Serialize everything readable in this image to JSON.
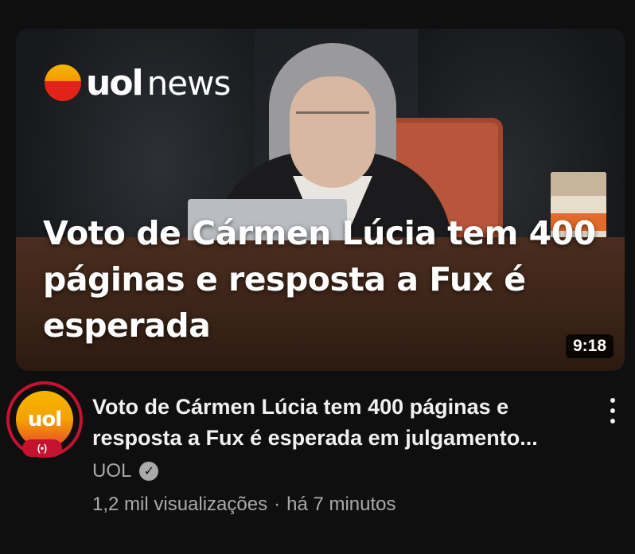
{
  "thumbnail": {
    "logo_brand": "uol",
    "logo_product": "news",
    "overlay_title": "Voto de Cármen Lúcia tem 400 páginas e resposta a Fux é esperada",
    "duration": "9:18"
  },
  "channel": {
    "avatar_text": "uol",
    "live_icon": "(•)",
    "name": "UOL",
    "verified_icon": "✓"
  },
  "video": {
    "title": "Voto de Cármen Lúcia tem 400 páginas e resposta a Fux é esperada em julgamento...",
    "views": "1,2 mil visualizações",
    "separator": "·",
    "age": "há 7 minutos"
  },
  "colors": {
    "background": "#0f0f0f",
    "text_primary": "#f1f1f1",
    "text_secondary": "#aaaaaa",
    "brand_red": "#c41230",
    "brand_yellow": "#f7b500"
  }
}
